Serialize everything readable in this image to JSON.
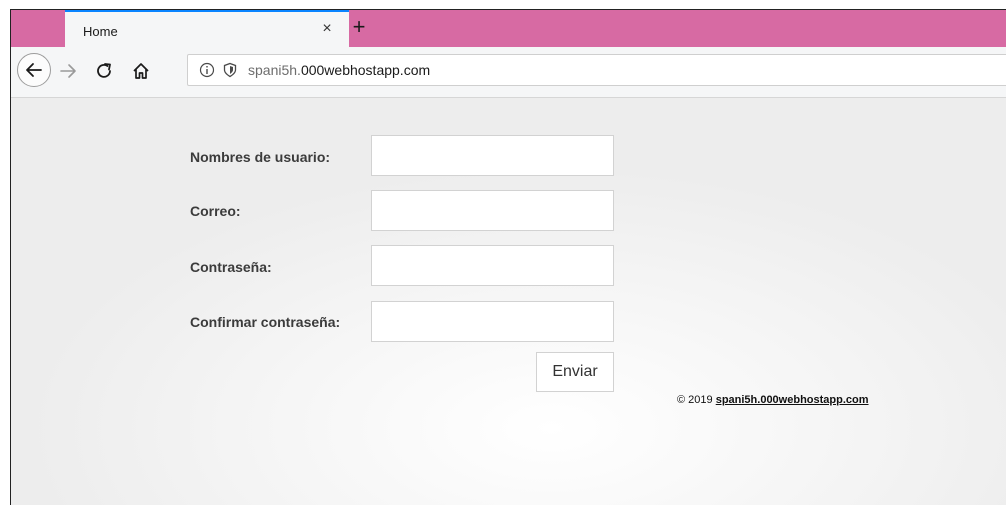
{
  "browser": {
    "tab_title": "Home",
    "tab_close": "×",
    "new_tab": "+",
    "url_subdomain": "spani5h.",
    "url_domain": "000webhostapp.com",
    "accent_color": "#0a84ff",
    "tabstrip_color": "#d76aa3"
  },
  "form": {
    "username_label": "Nombres de usuario:",
    "email_label": "Correo:",
    "password_label": "Contraseña:",
    "confirm_label": "Confirmar contraseña:",
    "username_value": "",
    "email_value": "",
    "password_value": "",
    "confirm_value": "",
    "submit_label": "Enviar"
  },
  "footer": {
    "copyright": "© 2019",
    "link_text": "spani5h.000webhostapp.com"
  }
}
